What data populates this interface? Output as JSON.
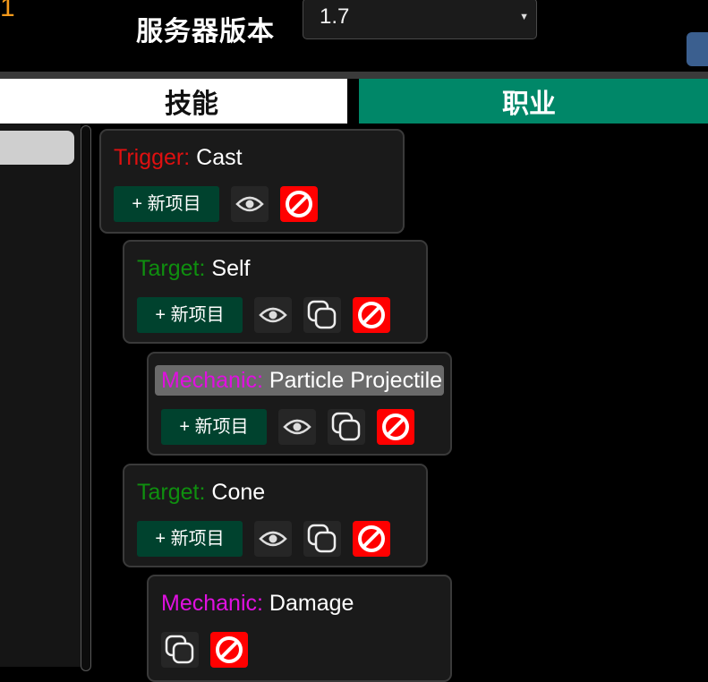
{
  "header": {
    "corner_glyph": "1",
    "server_version_label": "服务器版本",
    "server_version_value": "1.7"
  },
  "tabs": [
    {
      "label": "技能"
    },
    {
      "label": "职业"
    }
  ],
  "colors": {
    "trigger": "#e01010",
    "target": "#0f8f0f",
    "mechanic": "#e010e0",
    "active_tab": "#008768",
    "new_button": "#00422e",
    "delete_button": "#ff0000"
  },
  "components": [
    {
      "type": "Trigger:",
      "name": "Cast",
      "new_label": "+ 新项目",
      "icons": [
        "eye-icon",
        "no-sign-icon"
      ]
    },
    {
      "type": "Target:",
      "name": "Self",
      "new_label": "+ 新项目",
      "icons": [
        "eye-icon",
        "copy-icon",
        "no-sign-icon"
      ]
    },
    {
      "type": "Mechanic:",
      "name": "Particle Projectile",
      "new_label": "+ 新项目",
      "icons": [
        "eye-icon",
        "copy-icon",
        "no-sign-icon"
      ]
    },
    {
      "type": "Target:",
      "name": "Cone",
      "new_label": "+ 新项目",
      "icons": [
        "eye-icon",
        "copy-icon",
        "no-sign-icon"
      ]
    },
    {
      "type": "Mechanic:",
      "name": "Damage",
      "icons": [
        "copy-icon",
        "no-sign-icon"
      ]
    }
  ]
}
